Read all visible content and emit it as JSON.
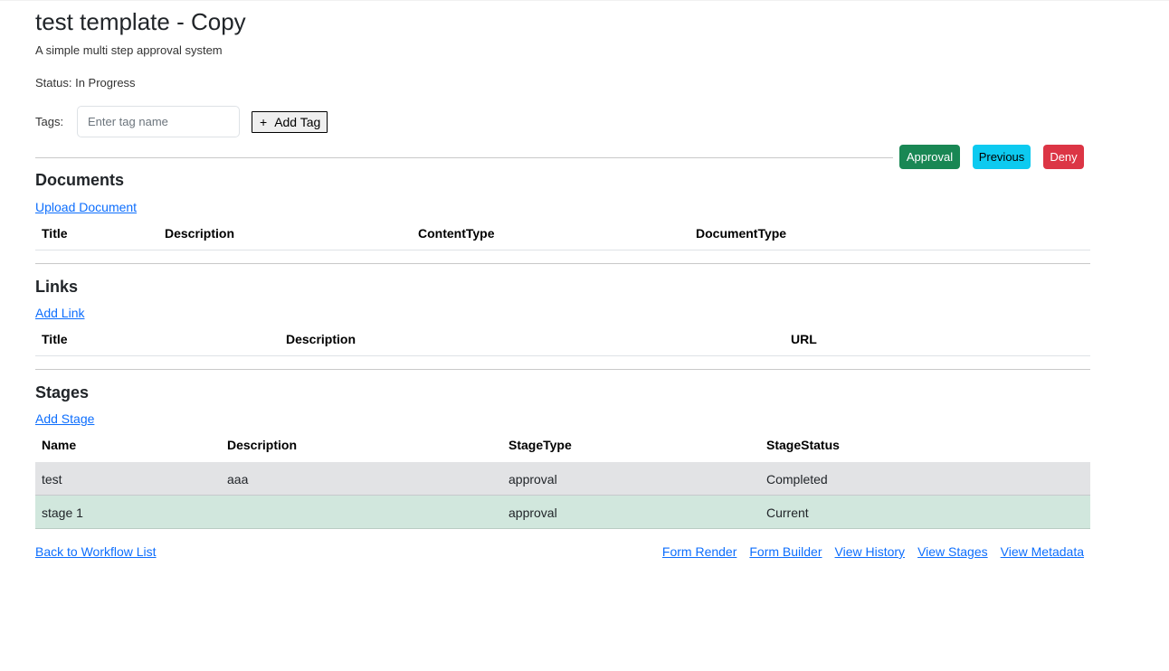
{
  "header": {
    "title": "test template - Copy",
    "subtitle": "A simple multi step approval system",
    "status": "Status: In Progress"
  },
  "tags": {
    "label": "Tags:",
    "input_placeholder": "Enter tag name",
    "input_value": "",
    "add_button_label": "Add Tag",
    "add_button_icon": "plus-icon"
  },
  "actions": {
    "approval": "Approval",
    "previous": "Previous",
    "deny": "Deny"
  },
  "documents": {
    "heading": "Documents",
    "upload_link": "Upload Document",
    "columns": [
      "Title",
      "Description",
      "ContentType",
      "DocumentType"
    ],
    "rows": []
  },
  "links": {
    "heading": "Links",
    "add_link": "Add Link",
    "columns": [
      "Title",
      "Description",
      "URL"
    ],
    "rows": []
  },
  "stages": {
    "heading": "Stages",
    "add_link": "Add Stage",
    "columns": [
      "Name",
      "Description",
      "StageType",
      "StageStatus"
    ],
    "rows": [
      {
        "name": "test",
        "description": "aaa",
        "type": "approval",
        "status": "Completed"
      },
      {
        "name": "stage 1",
        "description": "",
        "type": "approval",
        "status": "Current"
      }
    ]
  },
  "footer": {
    "back_link": "Back to Workflow List",
    "form_render": "Form Render",
    "form_builder": "Form Builder",
    "view_history": "View History",
    "view_stages": "View Stages",
    "view_metadata": "View Metadata"
  },
  "colors": {
    "approval": "#198754",
    "previous": "#0dcaf0",
    "deny": "#dc3545",
    "completed_row": "#e2e3e5",
    "current_row": "#d1e7dd",
    "link": "#0d6efd"
  }
}
